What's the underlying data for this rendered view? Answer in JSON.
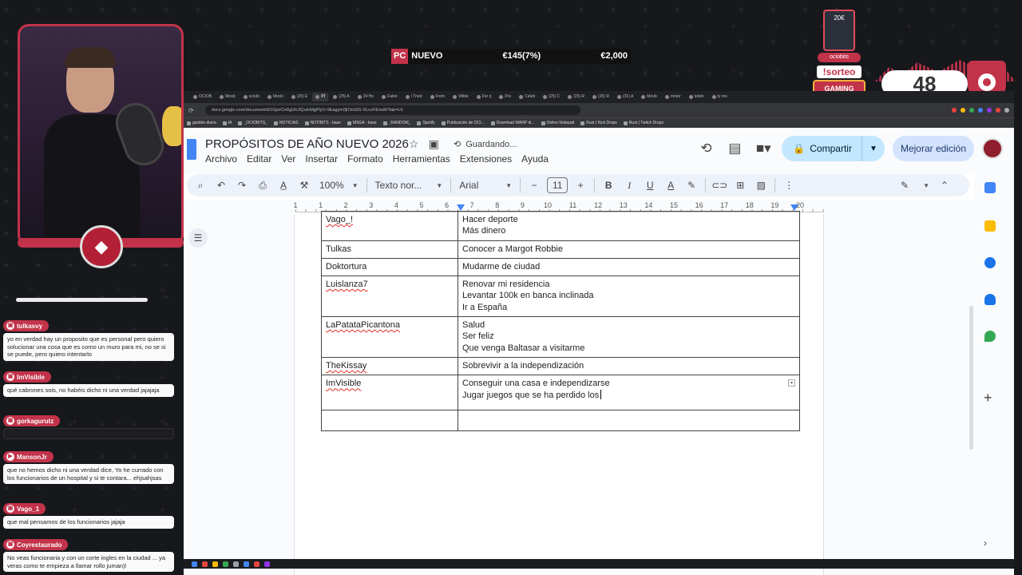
{
  "overlay": {
    "price_bar": {
      "pc": "PC",
      "nuevo": "NUEVO",
      "price1": "€145(7%)",
      "price2": "€2,000"
    },
    "sorteo": {
      "card_label": "20€",
      "tag": "ociobits",
      "sorteo_label": "!sorteo",
      "gaming_label": "GAMING"
    },
    "counter": {
      "value": "48"
    }
  },
  "chat": {
    "messages": [
      {
        "user": "tulkasvy",
        "text": "yo en verdad hay un proposito que es personal pero quiero solucionar una cosa que es como un muro para mi, no se si se puede, pero quiero intentarlo"
      },
      {
        "user": "ImVisible",
        "text": "qué cabrones sois, no habéis dicho ni una verdad jajajaja"
      },
      {
        "user": "gorkagurutz",
        "text": ""
      },
      {
        "user": "MansonJr",
        "text": "que no hemos dicho ni una verdad dice, Yo he currado con los funcionarios de un hospital y si te contara... ehjsahjsas"
      },
      {
        "user": "Vago_1",
        "text": "que mal pensamos de los funcionarios jajaja"
      },
      {
        "user": "Coyrestaurado",
        "text": "No veas funcionaria y con un corte ingles en la ciudad ... ya veras como te empieza a llamar rollo juman)!"
      }
    ]
  },
  "browser": {
    "tabs": [
      "OCIOB",
      "Moob",
      "ociobi",
      "Mocki",
      "(25) E",
      "PI",
      "(25) A",
      "24 Ho",
      "Fabio",
      "I Tried",
      "From",
      "Wilde",
      "For q",
      "Pro",
      "Celeb",
      "(25) C",
      "(25) R",
      "(25) R",
      "(31) A",
      "Moob",
      "motor",
      "teleln",
      "ty mo"
    ],
    "address": "docs.google.com/document/d/1GprrCn6gUlc3QuInMgPlyO-9Eagym3jIOmDG-SLnzFE/edit?tab=t.0",
    "bookmarks": [
      "gestión diaria",
      "IA",
      "_OCIOBITS_",
      "NOTICIAS",
      "NOTIBITS - base",
      "MSGA - base",
      "_RANDOM_",
      "Spotify",
      "Publicación de OCI...",
      "Download WARP di...",
      "Online Notepad",
      "Rust | Kick Drops",
      "Rust | Twitch Drops"
    ]
  },
  "doc": {
    "title": "PROPÓSITOS DE AÑO NUEVO 2026",
    "saving": "Guardando...",
    "menu": [
      "Archivo",
      "Editar",
      "Ver",
      "Insertar",
      "Formato",
      "Herramientas",
      "Extensiones",
      "Ayuda"
    ],
    "share_label": "Compartir",
    "upgrade_label": "Mejorar edición",
    "toolbar": {
      "zoom": "100%",
      "style": "Texto nor...",
      "font": "Arial",
      "font_size": "11"
    },
    "ruler_numbers": [
      "1",
      "1",
      "2",
      "3",
      "4",
      "5",
      "6",
      "7",
      "8",
      "9",
      "10",
      "11",
      "12",
      "13",
      "14",
      "15",
      "16",
      "17",
      "18",
      "19",
      "20"
    ],
    "table": [
      {
        "name": "Vago_!",
        "items": [
          "Hacer deporte",
          "Más dinero"
        ]
      },
      {
        "name": "Tulkas",
        "items": [
          "Conocer a Margot Robbie"
        ]
      },
      {
        "name": "Doktortura",
        "items": [
          "Mudarme de ciudad"
        ]
      },
      {
        "name": "Luislanza7",
        "items": [
          "Renovar mi residencia",
          "Levantar 100k en banca inclinada",
          "Ir a España"
        ]
      },
      {
        "name": "LaPatataPicantona",
        "items": [
          "Salud",
          "Ser feliz",
          "Que venga Baltasar a visitarme"
        ]
      },
      {
        "name": "TheKissay",
        "items": [
          "Sobrevivir a la independización"
        ]
      },
      {
        "name": "ImVisible",
        "items": [
          "Conseguir una casa e independizarse",
          "Jugar juegos que se ha perdido los"
        ]
      },
      {
        "name": "",
        "items": [
          ""
        ]
      }
    ]
  },
  "colors": {
    "accent": "#c2334a",
    "share_bg": "#c2e7ff",
    "toolbar_bg": "#edf2fa"
  }
}
